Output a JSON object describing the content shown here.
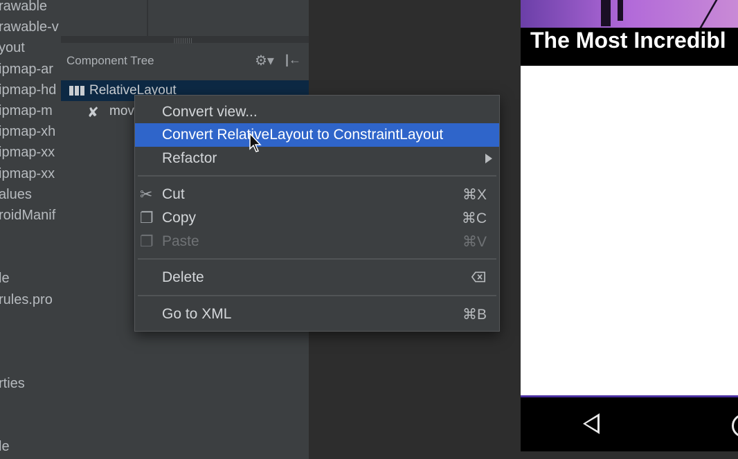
{
  "project_panel": {
    "items": [
      "rawable",
      "rawable-v",
      "yout",
      "ipmap-ar",
      "ipmap-hd",
      "ipmap-m",
      "ipmap-xh",
      "ipmap-xx",
      "ipmap-xx",
      "alues",
      "roidManif",
      "le",
      "rules.pro",
      "rties",
      "le"
    ]
  },
  "component_tree": {
    "title": "Component Tree",
    "gear_icon": "gear-icon",
    "collapse_icon": "collapse-icon",
    "root_label": "RelativeLayout",
    "child_label": "mov"
  },
  "context_menu": {
    "items": [
      {
        "label": "Convert view...",
        "shortcut": ""
      },
      {
        "label": "Convert RelativeLayout to ConstraintLayout",
        "shortcut": ""
      },
      {
        "label": "Refactor",
        "shortcut": ""
      },
      {
        "label": "Cut",
        "shortcut": "⌘X"
      },
      {
        "label": "Copy",
        "shortcut": "⌘C"
      },
      {
        "label": "Paste",
        "shortcut": "⌘V"
      },
      {
        "label": "Delete",
        "shortcut": ""
      },
      {
        "label": "Go to XML",
        "shortcut": "⌘B"
      }
    ]
  },
  "preview": {
    "title": "The Most Incredibl"
  },
  "colors": {
    "highlight": "#2f65ca",
    "menu_bg": "#3c3f41",
    "panel_bg": "#3c3f41",
    "tree_selected": "#0d2944"
  }
}
